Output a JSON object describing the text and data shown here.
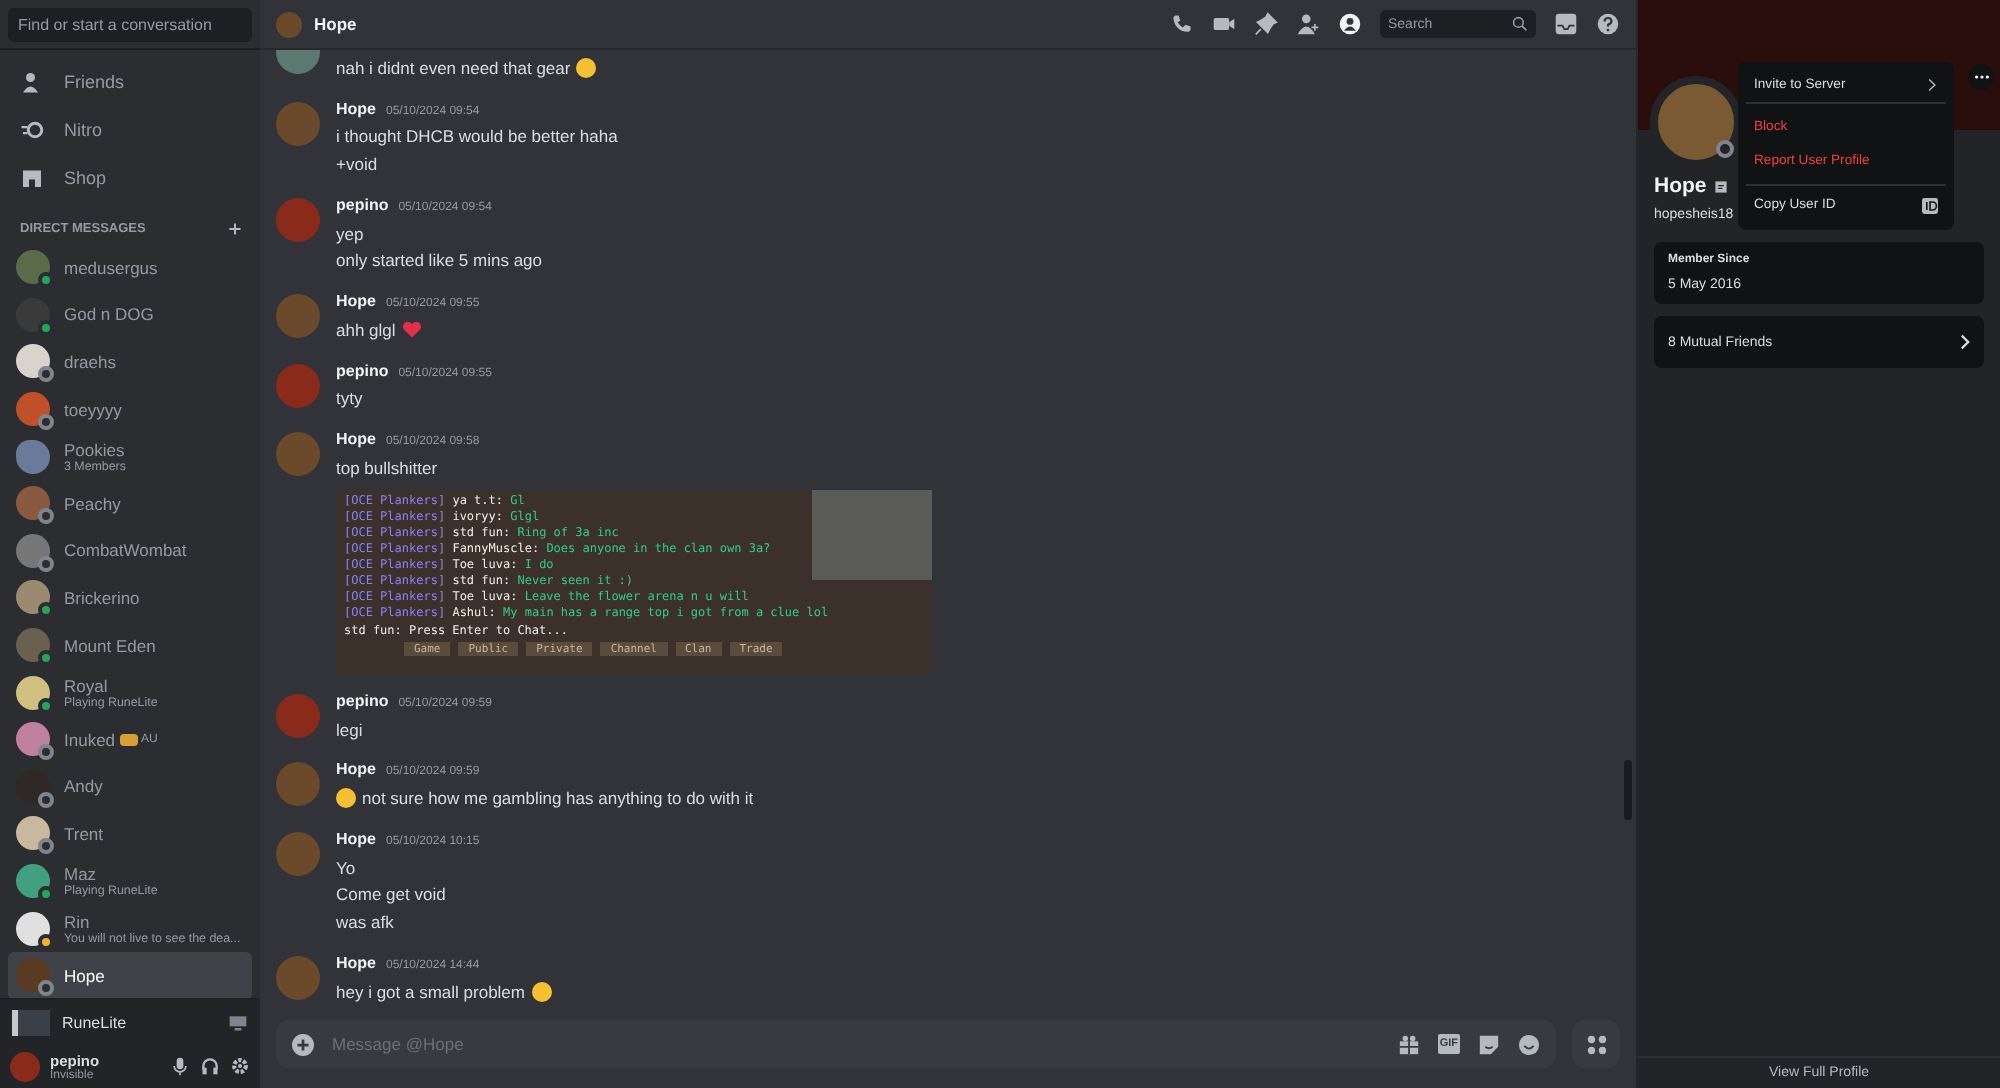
{
  "sidebar": {
    "search_placeholder": "Find or start a conversation",
    "nav": [
      {
        "label": "Friends",
        "kind": "friends"
      },
      {
        "label": "Nitro",
        "kind": "nitro"
      },
      {
        "label": "Shop",
        "kind": "shop"
      }
    ],
    "dm_header": "DIRECT MESSAGES",
    "dms": [
      {
        "name": "medusergus",
        "kind": "user",
        "online": true,
        "idle": false,
        "selected": false
      },
      {
        "name": "God n DOG",
        "kind": "user",
        "online": true,
        "idle": false,
        "selected": false
      },
      {
        "name": "draehs",
        "kind": "user",
        "online": false,
        "idle": false,
        "selected": false
      },
      {
        "name": "toeyyyy",
        "kind": "user",
        "online": false,
        "idle": false,
        "selected": false
      },
      {
        "name": "Pookies",
        "sub": "3 Members",
        "kind": "group",
        "selected": false
      },
      {
        "name": "Peachy",
        "kind": "user",
        "online": false,
        "idle": false,
        "selected": false
      },
      {
        "name": "CombatWombat",
        "kind": "user",
        "online": false,
        "idle": false,
        "selected": false
      },
      {
        "name": "Brickerino",
        "kind": "user",
        "online": true,
        "idle": false,
        "selected": false
      },
      {
        "name": "Mount Eden",
        "kind": "user",
        "online": true,
        "idle": false,
        "selected": false
      },
      {
        "name": "Royal",
        "sub": "Playing RuneLite",
        "kind": "user",
        "online": true,
        "idle": false,
        "selected": false
      },
      {
        "name": "Inuked",
        "tag": "AU",
        "kind": "user",
        "online": false,
        "idle": false,
        "selected": false
      },
      {
        "name": "Andy",
        "kind": "user",
        "online": false,
        "idle": false,
        "selected": false
      },
      {
        "name": "Trent",
        "kind": "user",
        "online": false,
        "idle": false,
        "selected": false
      },
      {
        "name": "Maz",
        "sub": "Playing RuneLite",
        "kind": "user",
        "online": true,
        "idle": false,
        "selected": false
      },
      {
        "name": "Rin",
        "sub": "You will not live to see the dea...",
        "kind": "user",
        "online": false,
        "idle": true,
        "selected": false
      },
      {
        "name": "Hope",
        "kind": "user",
        "online": false,
        "idle": false,
        "selected": true
      }
    ],
    "activity": {
      "title": "RuneLite"
    },
    "user": {
      "name": "pepino",
      "status_text": "Invisible"
    }
  },
  "chat": {
    "title": "Hope",
    "search_placeholder": "Search",
    "messages": [
      {
        "lines": [
          {
            "text": "nah i didnt even need that gear",
            "kind": "emoji_after"
          }
        ]
      },
      {
        "author": "Hope",
        "time": "05/10/2024 09:54",
        "lines": [
          {
            "text": "i thought DHCB would be better haha"
          },
          {
            "text": "+void"
          }
        ]
      },
      {
        "author": "pepino",
        "time": "05/10/2024 09:54",
        "lines": [
          {
            "text": "yep"
          },
          {
            "text": "only started like 5 mins ago"
          }
        ]
      },
      {
        "author": "Hope",
        "time": "05/10/2024 09:55",
        "lines": [
          {
            "text": "ahh glgl",
            "kind": "heart_after"
          }
        ]
      },
      {
        "author": "pepino",
        "time": "05/10/2024 09:55",
        "lines": [
          {
            "text": "tyty"
          }
        ]
      },
      {
        "author": "Hope",
        "time": "05/10/2024 09:58",
        "lines": [
          {
            "text": "top bullshitter"
          }
        ],
        "attachment": {
          "chat_lines": [
            {
              "clan": "[OCE Plankers]",
              "name": "ya t.t:",
              "text": "Gl"
            },
            {
              "clan": "[OCE Plankers]",
              "name": "ivoryy:",
              "text": "Glgl"
            },
            {
              "clan": "[OCE Plankers]",
              "name": "std fun:",
              "text": "Ring of 3a inc"
            },
            {
              "clan": "[OCE Plankers]",
              "name": "FannyMuscle:",
              "text": "Does anyone in the clan own 3a?"
            },
            {
              "clan": "[OCE Plankers]",
              "name": "Toe luva:",
              "text": "I do"
            },
            {
              "clan": "[OCE Plankers]",
              "name": "std fun:",
              "text": "Never seen it :)"
            },
            {
              "clan": "[OCE Plankers]",
              "name": "Toe luva:",
              "text": "Leave the flower arena n u will"
            },
            {
              "clan": "[OCE Plankers]",
              "name": "Ashul:",
              "text": "My main has a range top i got from a clue lol"
            }
          ],
          "input": "std fun: Press Enter to Chat...",
          "tabs": [
            "Game",
            "Public",
            "Private",
            "Channel",
            "Clan",
            "Trade"
          ]
        }
      },
      {
        "author": "pepino",
        "time": "05/10/2024 09:59",
        "lines": [
          {
            "text": "legi"
          }
        ]
      },
      {
        "author": "Hope",
        "time": "05/10/2024 09:59",
        "lines": [
          {
            "text": "not sure how me gambling has anything to do with it",
            "kind": "emoji_before"
          }
        ]
      },
      {
        "author": "Hope",
        "time": "05/10/2024 10:15",
        "lines": [
          {
            "text": "Yo"
          },
          {
            "text": "Come get void"
          },
          {
            "text": "was afk"
          }
        ]
      },
      {
        "author": "Hope",
        "time": "05/10/2024 14:44",
        "lines": [
          {
            "text": "hey i got a small problem",
            "kind": "emoji_after"
          }
        ]
      }
    ],
    "composer": {
      "placeholder": "Message @Hope",
      "gif_label": "GIF"
    }
  },
  "profile": {
    "name": "Hope",
    "username": "hopesheis18",
    "menu": [
      {
        "label": "Invite to Server",
        "kind": "submenu"
      },
      {
        "label": "Block",
        "kind": "danger"
      },
      {
        "label": "Report User Profile",
        "kind": "danger"
      },
      {
        "label": "Copy User ID",
        "kind": "id"
      }
    ],
    "member_since_label": "Member Since",
    "member_since": "5 May 2016",
    "mutual": "8 Mutual Friends",
    "view_full": "View Full Profile"
  }
}
